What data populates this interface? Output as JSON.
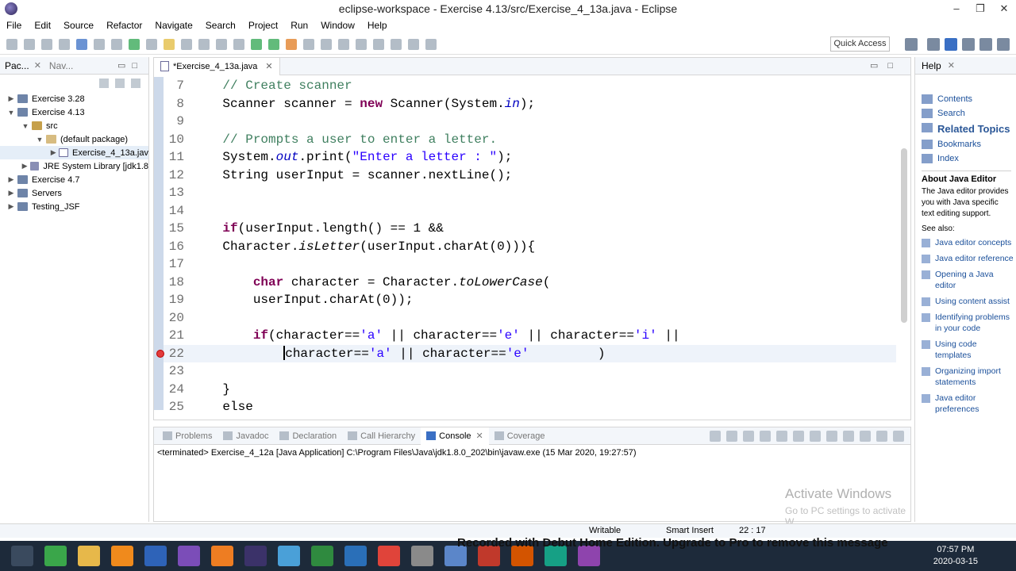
{
  "window": {
    "title": "eclipse-workspace - Exercise 4.13/src/Exercise_4_13a.java - Eclipse",
    "minimize": "–",
    "maximize": "❐",
    "close": "✕"
  },
  "menu": [
    "File",
    "Edit",
    "Source",
    "Refactor",
    "Navigate",
    "Search",
    "Project",
    "Run",
    "Window",
    "Help"
  ],
  "toolbar": {
    "quick_access": "Quick Access"
  },
  "explorer": {
    "tabs": [
      {
        "label": "Pac...",
        "close": "✕"
      },
      {
        "label": "Nav..."
      }
    ],
    "tree": [
      {
        "label": "Exercise 3.28",
        "twisty": "▶",
        "icon": "project-icon",
        "level": 0
      },
      {
        "label": "Exercise 4.13",
        "twisty": "▼",
        "icon": "project-icon",
        "level": 0
      },
      {
        "label": "src",
        "twisty": "▼",
        "icon": "package-folder-icon",
        "level": 1
      },
      {
        "label": "(default package)",
        "twisty": "▼",
        "icon": "package-icon",
        "level": 2
      },
      {
        "label": "Exercise_4_13a.jav",
        "twisty": "▶",
        "icon": "java-file-icon",
        "level": 3,
        "selected": true
      },
      {
        "label": "JRE System Library [jdk1.8",
        "twisty": "▶",
        "icon": "library-icon",
        "level": 1
      },
      {
        "label": "Exercise 4.7",
        "twisty": "▶",
        "icon": "project-icon",
        "level": 0
      },
      {
        "label": "Servers",
        "twisty": "▶",
        "icon": "project-icon",
        "level": 0
      },
      {
        "label": "Testing_JSF",
        "twisty": "▶",
        "icon": "project-icon",
        "level": 0
      }
    ]
  },
  "editor": {
    "tab_label": "*Exercise_4_13a.java",
    "tab_close": "✕",
    "lines": [
      {
        "n": "7",
        "segs": [
          [
            "    // Create scanner",
            "cm"
          ]
        ]
      },
      {
        "n": "8",
        "segs": [
          [
            "    Scanner scanner = ",
            ""
          ],
          [
            "new",
            "kw"
          ],
          [
            " Scanner(System.",
            ""
          ],
          [
            "in",
            "fi"
          ],
          [
            ");",
            ""
          ]
        ]
      },
      {
        "n": "9",
        "segs": []
      },
      {
        "n": "10",
        "segs": [
          [
            "    // Prompts a user to enter a letter.",
            "cm"
          ]
        ]
      },
      {
        "n": "11",
        "segs": [
          [
            "    System.",
            ""
          ],
          [
            "out",
            "fi"
          ],
          [
            ".print(",
            ""
          ],
          [
            "\"Enter a letter : \"",
            "st"
          ],
          [
            ");",
            ""
          ]
        ]
      },
      {
        "n": "12",
        "segs": [
          [
            "    String userInput = scanner.nextLine();",
            ""
          ]
        ]
      },
      {
        "n": "13",
        "segs": []
      },
      {
        "n": "14",
        "segs": []
      },
      {
        "n": "15",
        "segs": [
          [
            "    ",
            ""
          ],
          [
            "if",
            "kw"
          ],
          [
            "(userInput.length() == 1 &&",
            ""
          ]
        ]
      },
      {
        "n": "16",
        "segs": [
          [
            "    Character.",
            ""
          ],
          [
            "isLetter",
            "it"
          ],
          [
            "(userInput.charAt(0))){",
            ""
          ]
        ]
      },
      {
        "n": "17",
        "segs": []
      },
      {
        "n": "18",
        "segs": [
          [
            "        ",
            ""
          ],
          [
            "char",
            "kw"
          ],
          [
            " character = Character.",
            ""
          ],
          [
            "toLowerCase",
            "it"
          ],
          [
            "(",
            ""
          ]
        ]
      },
      {
        "n": "19",
        "segs": [
          [
            "        userInput.charAt(0));",
            ""
          ]
        ]
      },
      {
        "n": "20",
        "segs": []
      },
      {
        "n": "21",
        "segs": [
          [
            "        ",
            ""
          ],
          [
            "if",
            "kw"
          ],
          [
            "(character==",
            ""
          ],
          [
            "'a'",
            "st"
          ],
          [
            " || character==",
            ""
          ],
          [
            "'e'",
            "st"
          ],
          [
            " || character==",
            ""
          ],
          [
            "'i'",
            "st"
          ],
          [
            " ||",
            ""
          ]
        ]
      },
      {
        "n": "22",
        "segs": [
          [
            "            ",
            ""
          ],
          [
            "|",
            "caret"
          ],
          [
            "character==",
            ""
          ],
          [
            "'a'",
            "st"
          ],
          [
            " || character==",
            ""
          ],
          [
            "'e'",
            "st"
          ],
          [
            "         )",
            ""
          ]
        ],
        "current": true,
        "error": true
      },
      {
        "n": "23",
        "segs": []
      },
      {
        "n": "24",
        "segs": [
          [
            "    }",
            ""
          ]
        ]
      },
      {
        "n": "25",
        "segs": [
          [
            "    else",
            ""
          ]
        ]
      }
    ]
  },
  "console": {
    "tabs": [
      "Problems",
      "Javadoc",
      "Declaration",
      "Call Hierarchy",
      "Console",
      "Coverage"
    ],
    "active_tab": "Console",
    "close": "✕",
    "status": "<terminated> Exercise_4_12a [Java Application] C:\\Program Files\\Java\\jdk1.8.0_202\\bin\\javaw.exe (15 Mar 2020, 19:27:57)"
  },
  "activation": {
    "title": "Activate Windows",
    "subtitle": "Go to PC settings to activate W"
  },
  "help": {
    "tab_label": "Help",
    "close": "✕",
    "links": [
      "Contents",
      "Search"
    ],
    "related": "Related Topics",
    "links2": [
      "Bookmarks",
      "Index"
    ],
    "about_title": "About Java Editor",
    "about_text": "The Java editor provides you with Java specific text editing support.",
    "see_also": "See also:",
    "topics": [
      "Java editor concepts",
      "Java editor reference",
      "Opening a Java editor",
      "Using content assist",
      "Identifying problems in your code",
      "Using code templates",
      "Organizing import statements",
      "Java editor preferences"
    ]
  },
  "status": {
    "writable": "Writable",
    "insert": "Smart Insert",
    "position": "22 : 17"
  },
  "taskbar": {
    "time": "07:57 PM",
    "date": "2020-03-15",
    "recorded": "Recorded with Debut Home Edition. Upgrade to Pro to remove this message"
  }
}
